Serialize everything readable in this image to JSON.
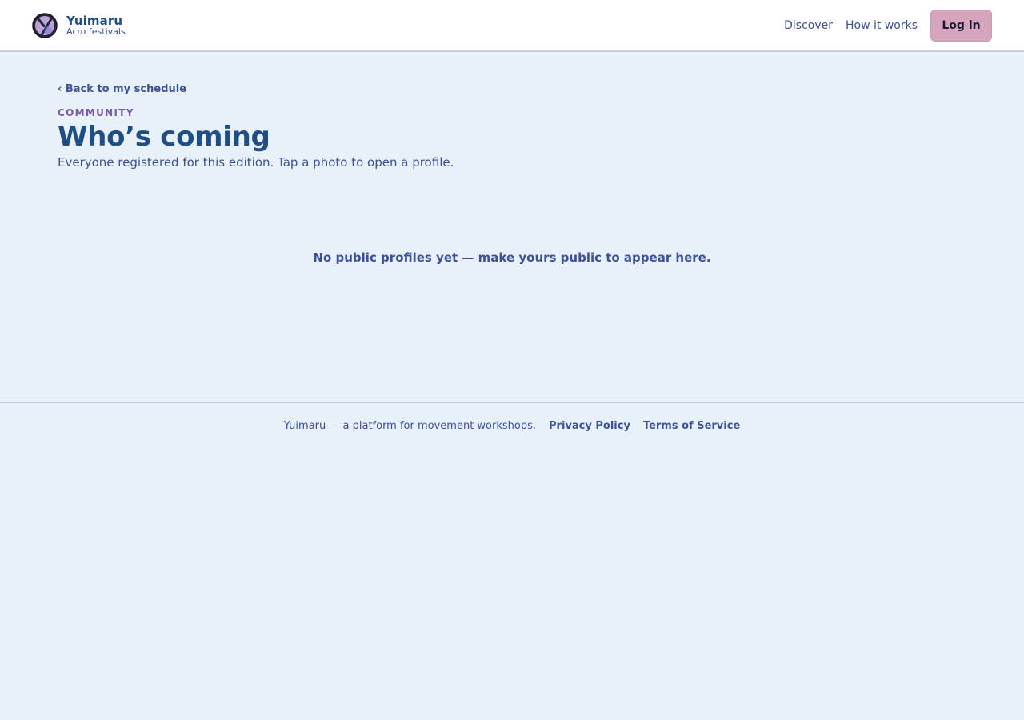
{
  "brand": {
    "name": "Yuimaru",
    "tagline": "Acro festivals",
    "logo_icon": "yuimaru-logo-icon"
  },
  "nav": {
    "links": [
      {
        "label": "Discover"
      },
      {
        "label": "How it works"
      }
    ],
    "login_label": "Log in"
  },
  "page": {
    "back_link": "‹ Back to my schedule",
    "eyebrow": "COMMUNITY",
    "title": "Who’s coming",
    "subtitle": "Everyone registered for this edition. Tap a photo to open a profile.",
    "empty_message": "No public profiles yet — make yours public to appear here."
  },
  "footer": {
    "text": "Yuimaru — a platform for movement workshops.",
    "links": [
      {
        "label": "Privacy Policy"
      },
      {
        "label": "Terms of Service"
      }
    ]
  },
  "colors": {
    "background": "#e8f1f8",
    "primary": "#1f4e85",
    "link": "#3d5196",
    "accent": "#7a5aa6",
    "login_button": "#d6a4bc"
  }
}
